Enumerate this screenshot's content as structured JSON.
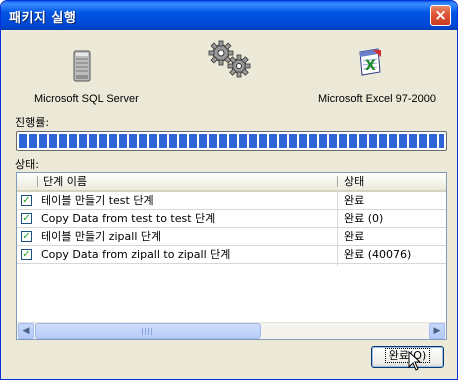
{
  "window": {
    "title": "패키지 실행",
    "close_glyph": "×"
  },
  "source": {
    "label": "Microsoft SQL Server",
    "icon": "server-icon"
  },
  "transfer": {
    "icon": "gears-icon"
  },
  "destination": {
    "label": "Microsoft Excel 97-2000",
    "icon": "excel-icon"
  },
  "progress": {
    "label": "진행률:",
    "fraction": 1.0
  },
  "status": {
    "label": "상태:",
    "columns": [
      "단계 이름",
      "상태"
    ],
    "rows": [
      {
        "step": "테이블 만들기 test 단계",
        "status": "완료",
        "checked": true
      },
      {
        "step": "Copy Data from test to test 단계",
        "status": "완료 (0)",
        "checked": true
      },
      {
        "step": "테이블 만들기 zipall 단계",
        "status": "완료",
        "checked": true
      },
      {
        "step": "Copy Data from zipall to zipall 단계",
        "status": "완료 (40076)",
        "checked": true
      }
    ]
  },
  "buttons": {
    "ok": "완료(O)"
  },
  "colors": {
    "titlebar": "#0055e5",
    "progress": "#2d65d6",
    "check": "#21a121"
  }
}
